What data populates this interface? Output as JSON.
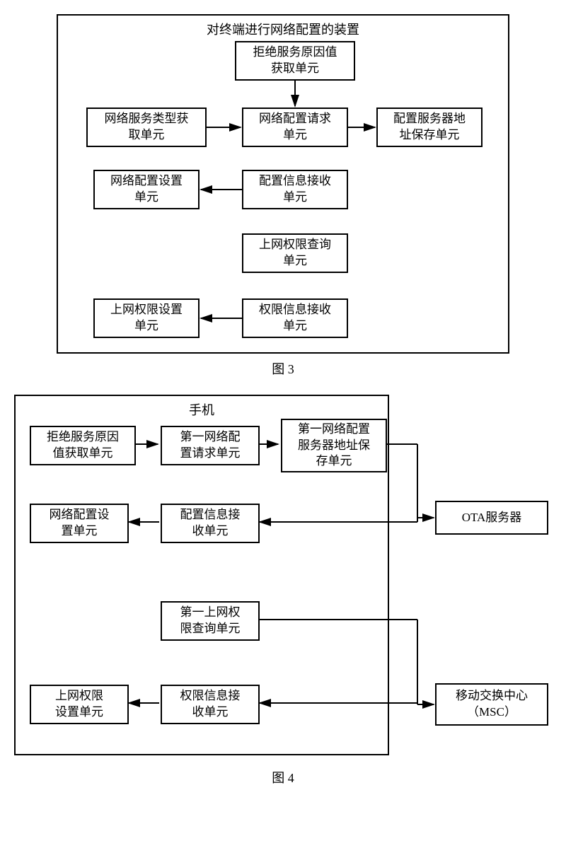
{
  "figure3": {
    "container_title": "对终端进行网络配置的装置",
    "label": "图 3",
    "nodes": {
      "reject_cause": "拒绝服务原因值\n获取单元",
      "service_type": "网络服务类型获\n取单元",
      "config_request": "网络配置请求\n单元",
      "server_addr": "配置服务器地\n址保存单元",
      "config_set": "网络配置设置\n单元",
      "config_recv": "配置信息接收\n单元",
      "perm_query": "上网权限查询\n单元",
      "perm_set": "上网权限设置\n单元",
      "perm_recv": "权限信息接收\n单元"
    }
  },
  "figure4": {
    "container_title": "手机",
    "label": "图 4",
    "nodes": {
      "reject_cause": "拒绝服务原因\n值获取单元",
      "config_request": "第一网络配\n置请求单元",
      "server_addr": "第一网络配置\n服务器地址保\n存单元",
      "config_set": "网络配置设\n置单元",
      "config_recv": "配置信息接\n收单元",
      "perm_query": "第一上网权\n限查询单元",
      "perm_set": "上网权限\n设置单元",
      "perm_recv": "权限信息接\n收单元",
      "ota": "OTA服务器",
      "msc": "移动交换中心\n（MSC）"
    }
  }
}
